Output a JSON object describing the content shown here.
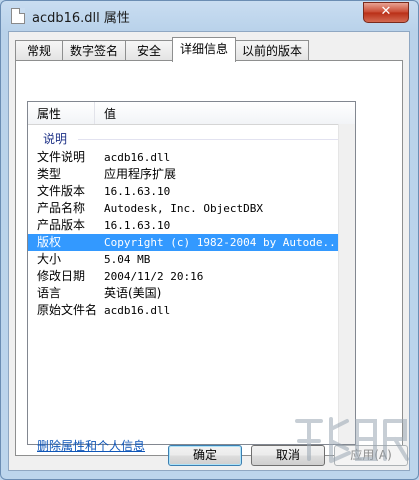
{
  "window": {
    "title": "acdb16.dll 属性",
    "close_glyph": "✕"
  },
  "tabs": [
    {
      "label": "常规"
    },
    {
      "label": "数字签名"
    },
    {
      "label": "安全"
    },
    {
      "label": "详细信息"
    },
    {
      "label": "以前的版本"
    }
  ],
  "list": {
    "header": {
      "col1": "属性",
      "col2": "值"
    },
    "group": "说明",
    "rows": [
      {
        "label": "文件说明",
        "value": "acdb16.dll"
      },
      {
        "label": "类型",
        "value": "应用程序扩展"
      },
      {
        "label": "文件版本",
        "value": "16.1.63.10"
      },
      {
        "label": "产品名称",
        "value": "Autodesk, Inc. ObjectDBX"
      },
      {
        "label": "产品版本",
        "value": "16.1.63.10"
      },
      {
        "label": "版权",
        "value": "Copyright (c) 1982-2004 by Autode..."
      },
      {
        "label": "大小",
        "value": "5.04 MB"
      },
      {
        "label": "修改日期",
        "value": "2004/11/2 20:16"
      },
      {
        "label": "语言",
        "value": "英语(美国)"
      },
      {
        "label": "原始文件名",
        "value": "acdb16.dll"
      }
    ]
  },
  "link": "删除属性和个人信息",
  "buttons": {
    "ok": "确定",
    "cancel": "取消",
    "apply": "应用(A)"
  }
}
